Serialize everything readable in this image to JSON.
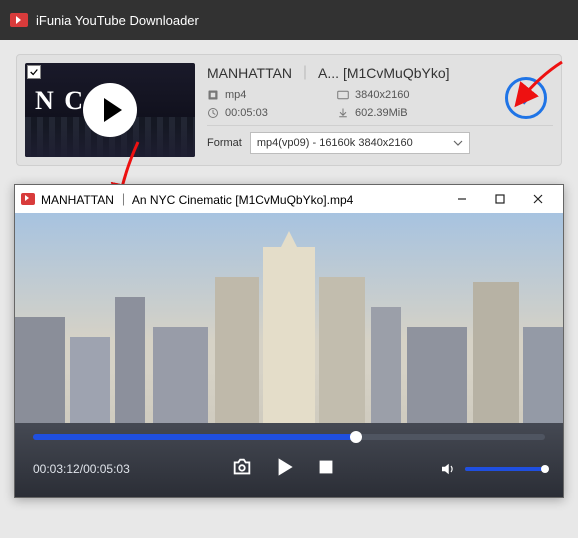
{
  "app": {
    "title": "iFunia YouTube Downloader"
  },
  "download": {
    "title_primary": "MANHATTAN",
    "title_secondary": "A... [M1CvMuQbYko]",
    "container": "mp4",
    "resolution": "3840x2160",
    "duration": "00:05:03",
    "filesize": "602.39MiB",
    "format_label": "Format",
    "format_selected": "mp4(vp09) - 16160k 3840x2160"
  },
  "player": {
    "window_title": "MANHATTAN ｜ An NYC Cinematic [M1CvMuQbYko].mp4",
    "current_time": "00:03:12",
    "total_time": "00:05:03"
  }
}
